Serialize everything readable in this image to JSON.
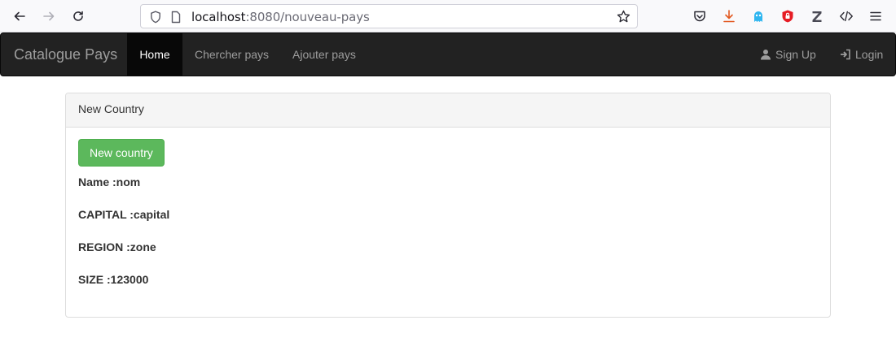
{
  "browser": {
    "url_host": "localhost",
    "url_rest": ":8080/nouveau-pays"
  },
  "navbar": {
    "brand": "Catalogue Pays",
    "items": [
      {
        "label": "Home",
        "active": true
      },
      {
        "label": "Chercher pays",
        "active": false
      },
      {
        "label": "Ajouter pays",
        "active": false
      }
    ],
    "right_items": [
      {
        "label": "Sign Up",
        "icon": "user-icon"
      },
      {
        "label": "Login",
        "icon": "login-icon"
      }
    ]
  },
  "panel": {
    "heading": "New Country",
    "button_label": "New country",
    "fields": [
      "Name :nom",
      "CAPITAL :capital",
      "REGION :zone",
      "SIZE :123000"
    ]
  },
  "colors": {
    "navbar_bg": "#222222",
    "success": "#5cb85c"
  }
}
